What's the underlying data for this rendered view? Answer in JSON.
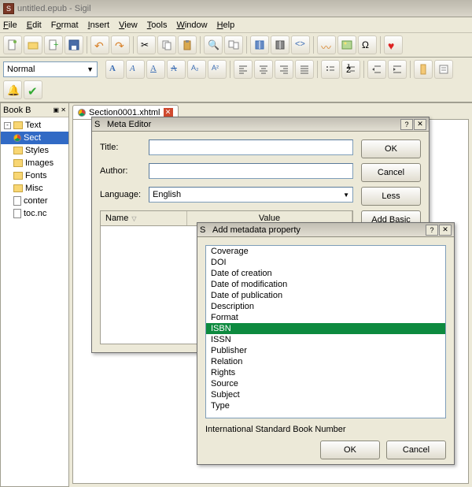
{
  "window": {
    "title": "untitled.epub - Sigil"
  },
  "menu": {
    "file": "File",
    "edit": "Edit",
    "format": "Format",
    "insert": "Insert",
    "view": "View",
    "tools": "Tools",
    "window": "Window",
    "help": "Help"
  },
  "styleSelect": "Normal",
  "sidebar": {
    "title": "Book B",
    "root": "Text",
    "sect": "Sect",
    "items": [
      "Styles",
      "Images",
      "Fonts",
      "Misc",
      "conter",
      "toc.nc"
    ]
  },
  "tab": {
    "label": "Section0001.xhtml"
  },
  "metaEditor": {
    "title": "Meta Editor",
    "titleLabel": "Title:",
    "authorLabel": "Author:",
    "languageLabel": "Language:",
    "languageValue": "English",
    "ok": "OK",
    "cancel": "Cancel",
    "less": "Less",
    "addBasic": "Add Basic",
    "nameCol": "Name",
    "valueCol": "Value"
  },
  "addProp": {
    "title": "Add metadata property",
    "items": [
      "Coverage",
      "DOI",
      "Date of creation",
      "Date of modification",
      "Date of publication",
      "Description",
      "Format",
      "ISBN",
      "ISSN",
      "Publisher",
      "Relation",
      "Rights",
      "Source",
      "Subject",
      "Type"
    ],
    "selected": "ISBN",
    "description": "International Standard Book Number",
    "ok": "OK",
    "cancel": "Cancel"
  }
}
